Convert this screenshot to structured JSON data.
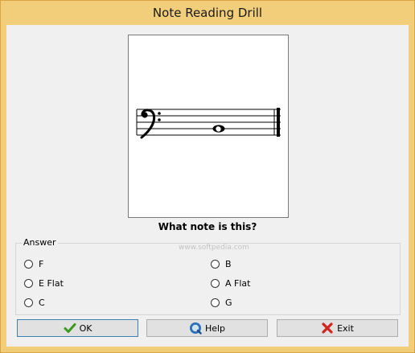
{
  "window": {
    "title": "Note Reading Drill"
  },
  "question": "What note is this?",
  "watermark": "www.softpedia.com",
  "answer_group": {
    "label": "Answer",
    "options": [
      "F",
      "E Flat",
      "C",
      "B",
      "A Flat",
      "G"
    ],
    "selected": null
  },
  "staff": {
    "clef": "bass",
    "note_icon": "whole-note"
  },
  "buttons": {
    "ok": "OK",
    "help": "Help",
    "exit": "Exit"
  },
  "colors": {
    "frame": "#f2ce7a",
    "ok_icon": "#3a9a1e",
    "help_icon": "#2c6fb8",
    "exit_icon": "#d0251f"
  }
}
